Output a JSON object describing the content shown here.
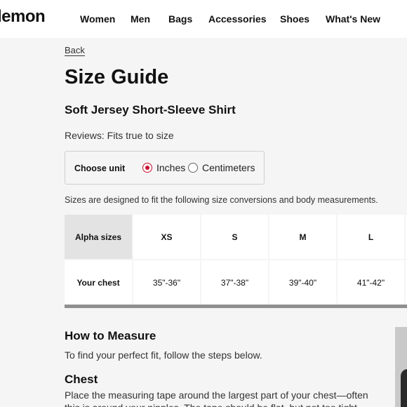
{
  "header": {
    "logo": "lemon",
    "nav": [
      "Women",
      "Men",
      "Bags",
      "Accessories",
      "Shoes",
      "What's New"
    ]
  },
  "back_label": "Back",
  "page_title": "Size Guide",
  "product_name": "Soft Jersey Short-Sleeve Shirt",
  "reviews": "Reviews: Fits true to size",
  "unit_selector": {
    "label": "Choose unit",
    "options": [
      "Inches",
      "Centimeters"
    ],
    "selected": "Inches"
  },
  "conversion_note": "Sizes are designed to fit the following size conversions and body measurements.",
  "size_table": {
    "row_headers": [
      "Alpha sizes",
      "Your chest"
    ],
    "sizes": [
      "XS",
      "S",
      "M",
      "L"
    ],
    "chest": [
      "35\"-36\"",
      "37\"-38\"",
      "39\"-40\"",
      "41\"-42\""
    ]
  },
  "how_to_measure": {
    "title": "How to Measure",
    "subtitle": "To find your perfect fit, follow the steps below.",
    "chest_title": "Chest",
    "chest_text": "Place the measuring tape around the largest part of your chest—often this is around your nipples. The tape should be flat, but not too tight."
  },
  "colors": {
    "accent": "#c8102e",
    "page_bg": "#f5f5f5",
    "header_cell_bg": "#e3e3e3",
    "table_bar": "#8f8f8f"
  }
}
